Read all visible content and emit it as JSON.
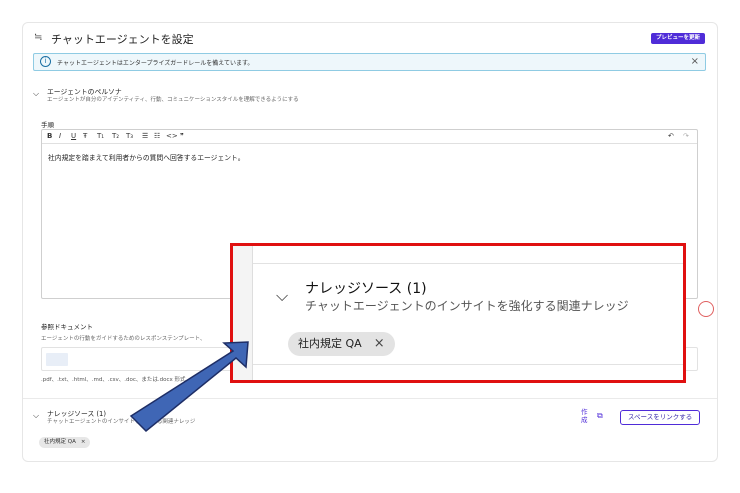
{
  "header": {
    "settings_icon": "sliders-icon",
    "title": "チャットエージェントを設定",
    "preview_button": "プレビューを更新"
  },
  "banner": {
    "info_icon": "info-icon",
    "text": "チャットエージェントはエンタープライズガードレールを備えています。",
    "close_icon": "close-icon",
    "close": "×"
  },
  "persona": {
    "chevron": "⌵",
    "title": "エージェントのペルソナ",
    "subtitle": "エージェントが自分のアイデンティティ、行動、コミュニケーションスタイルを理解できるようにする"
  },
  "instructions": {
    "label": "手順",
    "toolbar": [
      "B",
      "I",
      "U",
      "Ŧ",
      "T₁",
      "T₂",
      "T₃",
      "☰",
      "☷",
      "<>",
      "❞"
    ],
    "undo": "↶",
    "redo": "↷",
    "content": "社内規定を踏まえて利用者からの質問へ回答するエージェント。"
  },
  "reference": {
    "label": "参照ドキュメント",
    "subtitle": "エージェントの行動をガイドするためのレスポンステンプレート、",
    "types": ".pdf、.txt、.html、.md、.csv、.doc、または.docx 形式"
  },
  "knowledge": {
    "title": "ナレッジソース (1)",
    "subtitle": "チャットエージェントのインサイトを強化する関連ナレッジ",
    "create": "作成",
    "link_button": "スペースをリンクする",
    "chip": "社内規定 QA",
    "chip_close": "×"
  },
  "zoom": {
    "title": "ナレッジソース (1)",
    "subtitle": "チャットエージェントのインサイトを強化する関連ナレッジ",
    "chip": "社内規定 QA",
    "chip_close": "×"
  },
  "colors": {
    "accent": "#4f2cd8",
    "highlight": "#e01010",
    "arrow_fill": "#3f66b5",
    "arrow_stroke": "#1e2e66"
  }
}
